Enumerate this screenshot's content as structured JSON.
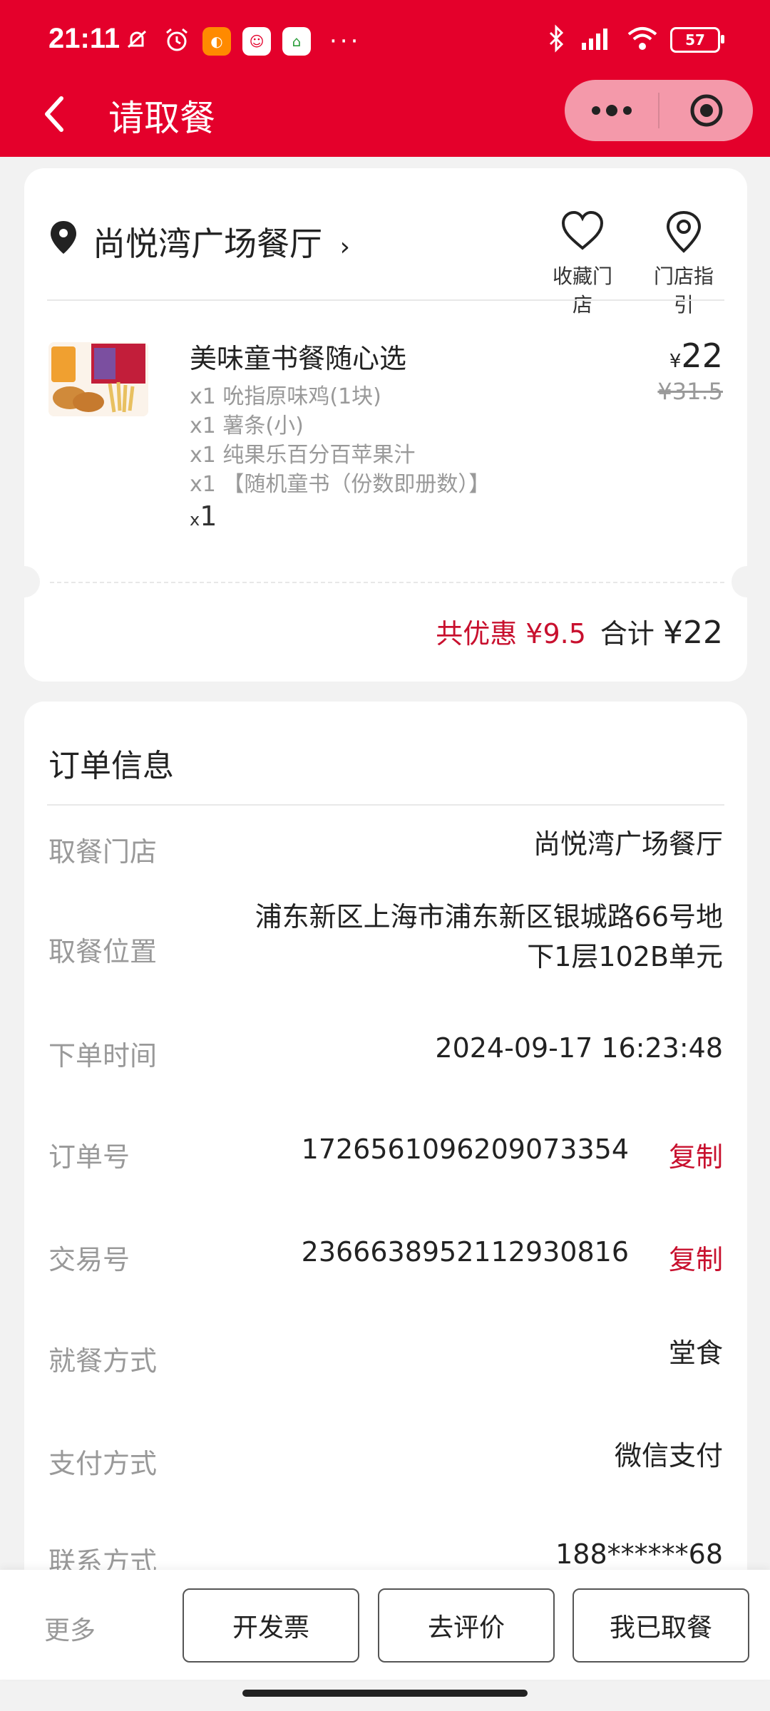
{
  "status_bar": {
    "time": "21:11",
    "battery": "57",
    "dots": "···"
  },
  "nav": {
    "title": "请取餐"
  },
  "store": {
    "name": "尚悦湾广场餐厅",
    "favorite_label": "收藏门店",
    "directions_label": "门店指引"
  },
  "product": {
    "name": "美味童书餐随心选",
    "items": [
      "x1 吮指原味鸡(1块)",
      "x1 薯条(小)",
      "x1 纯果乐百分百苹果汁",
      "x1 【随机童书（份数即册数）】"
    ],
    "qty_prefix": "x",
    "qty": "1",
    "currency": "¥",
    "price": "22",
    "original_price": "¥31.5"
  },
  "totals": {
    "discount": "共优惠 ¥9.5",
    "total_label": "合计",
    "total": "¥22"
  },
  "order_info": {
    "title": "订单信息",
    "rows": [
      {
        "label": "取餐门店",
        "value": "尚悦湾广场餐厅"
      },
      {
        "label": "取餐位置",
        "value_line1": "浦东新区上海市浦东新区银城路66号地",
        "value_line2": "下1层102B单元"
      },
      {
        "label": "下单时间",
        "value": "2024-09-17 16:23:48"
      },
      {
        "label": "订单号",
        "value": "1726561096209073354",
        "action": "复制"
      },
      {
        "label": "交易号",
        "value": "2366638952112930816",
        "action": "复制"
      },
      {
        "label": "就餐方式",
        "value": "堂食"
      },
      {
        "label": "支付方式",
        "value": "微信支付"
      },
      {
        "label": "联系方式",
        "value": "188******68"
      }
    ]
  },
  "bottom_bar": {
    "more": "更多",
    "invoice": "开发票",
    "review": "去评价",
    "picked_up": "我已取餐"
  },
  "colors": {
    "brand_red": "#e4002b",
    "accent_red": "#c8102e"
  }
}
